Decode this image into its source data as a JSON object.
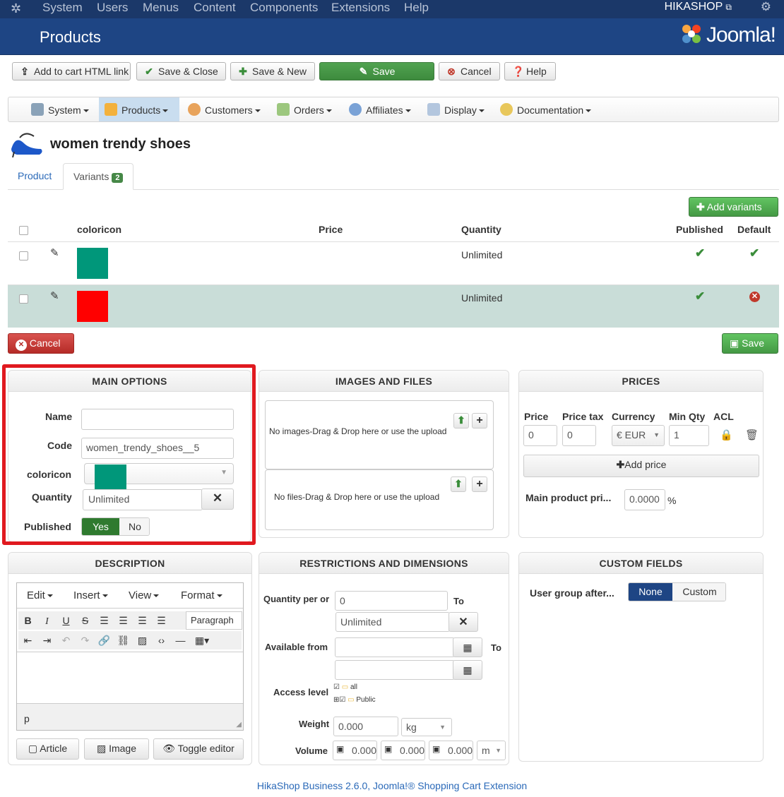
{
  "topbar": {
    "menu": [
      "System",
      "Users",
      "Menus",
      "Content",
      "Components",
      "Extensions",
      "Help"
    ],
    "right_label": "HIKASHOP"
  },
  "header": {
    "title": "Products",
    "logo_text": "Joomla!"
  },
  "toolbar": {
    "add_to_cart": "Add to cart HTML link",
    "save_close": "Save & Close",
    "save_new": "Save & New",
    "save": "Save",
    "cancel": "Cancel",
    "help": "Help"
  },
  "nav": [
    "System",
    "Products",
    "Customers",
    "Orders",
    "Affiliates",
    "Display",
    "Documentation"
  ],
  "product": {
    "title": "women trendy shoes"
  },
  "tabs": {
    "product": "Product",
    "variants": "Variants",
    "variants_count": "2"
  },
  "variants": {
    "add_button": "Add variants",
    "headers": {
      "coloricon": "coloricon",
      "price": "Price",
      "quantity": "Quantity",
      "published": "Published",
      "default": "Default"
    },
    "rows": [
      {
        "color": "#00977a",
        "quantity": "Unlimited",
        "published": true,
        "default": true
      },
      {
        "color": "#ff0000",
        "quantity": "Unlimited",
        "published": true,
        "default": false
      }
    ],
    "cancel": "Cancel",
    "save": "Save"
  },
  "main_options": {
    "title": "MAIN OPTIONS",
    "name_label": "Name",
    "name_value": "",
    "code_label": "Code",
    "code_value": "women_trendy_shoes__5",
    "coloricon_label": "coloricon",
    "coloricon_color": "#00977a",
    "quantity_label": "Quantity",
    "quantity_value": "Unlimited",
    "published_label": "Published",
    "yes": "Yes",
    "no": "No"
  },
  "images_files": {
    "title": "IMAGES AND FILES",
    "images_text": "No images-Drag & Drop here or use the upload",
    "files_text": "No files-Drag & Drop here or use the upload"
  },
  "prices": {
    "title": "PRICES",
    "price_label": "Price",
    "price_tax_label": "Price tax",
    "currency_label": "Currency",
    "min_qty_label": "Min Qty",
    "acl_label": "ACL",
    "price_value": "0",
    "price_tax_value": "0",
    "currency_value": "€ EUR",
    "min_qty_value": "1",
    "add_price": "Add price",
    "main_price_label": "Main product pri...",
    "main_price_value": "0.0000",
    "percent": "%"
  },
  "description": {
    "title": "DESCRIPTION",
    "menus": [
      "Edit",
      "Insert",
      "View",
      "Format"
    ],
    "paragraph": "Paragraph",
    "status_path": "p",
    "article_button": "Article",
    "image_button": "Image",
    "toggle_button": "Toggle editor"
  },
  "restrictions": {
    "title": "RESTRICTIONS AND DIMENSIONS",
    "qty_per_order_label": "Quantity per or",
    "qty_min_value": "0",
    "to_label": "To",
    "qty_max_value": "Unlimited",
    "available_from_label": "Available from",
    "access_level_label": "Access level",
    "access_all": "all",
    "access_public": "Public",
    "weight_label": "Weight",
    "weight_value": "0.000",
    "weight_unit": "kg",
    "volume_label": "Volume",
    "vol_x": "0.000",
    "vol_y": "0.000",
    "vol_z": "0.000",
    "volume_unit": "m"
  },
  "custom_fields": {
    "title": "CUSTOM FIELDS",
    "user_group_label": "User group after...",
    "none": "None",
    "custom": "Custom"
  },
  "footer": "HikaShop Business 2.6.0, Joomla!® Shopping Cart Extension",
  "colors": {
    "header_bg": "#1e4584",
    "topbar_bg": "#1b3869",
    "green": "#51a351",
    "red_highlight": "#e0191f",
    "selected_row": "#c9ddd8"
  }
}
